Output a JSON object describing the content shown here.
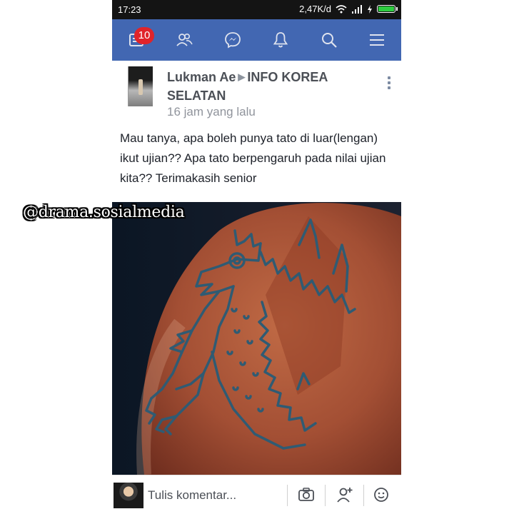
{
  "status_bar": {
    "time": "17:23",
    "network_speed": "2,47K/d",
    "icons": [
      "wifi-icon",
      "signal-icon",
      "charging-icon",
      "battery-icon"
    ]
  },
  "navbar": {
    "background": "#4267b2",
    "items": [
      {
        "icon": "news-feed-icon",
        "badge": "10"
      },
      {
        "icon": "friends-icon"
      },
      {
        "icon": "messenger-icon"
      },
      {
        "icon": "notifications-bell-icon"
      },
      {
        "icon": "search-icon"
      },
      {
        "icon": "menu-icon"
      }
    ]
  },
  "post": {
    "author": "Lukman Ae",
    "group": "INFO KOREA SELATAN",
    "time": "16 jam yang lalu",
    "text": "Mau tanya, apa boleh punya tato di luar(lengan) ikut ujian?? Apa tato berpengaruh pada nilai ujian kita?? Terimakasih senior",
    "photo_description_icon": "tattoo-photo"
  },
  "watermark": "@drama.sosialmedia",
  "comment_bar": {
    "placeholder": "Tulis komentar...",
    "icons": [
      "camera-icon",
      "tag-friend-icon",
      "emoji-icon"
    ]
  }
}
